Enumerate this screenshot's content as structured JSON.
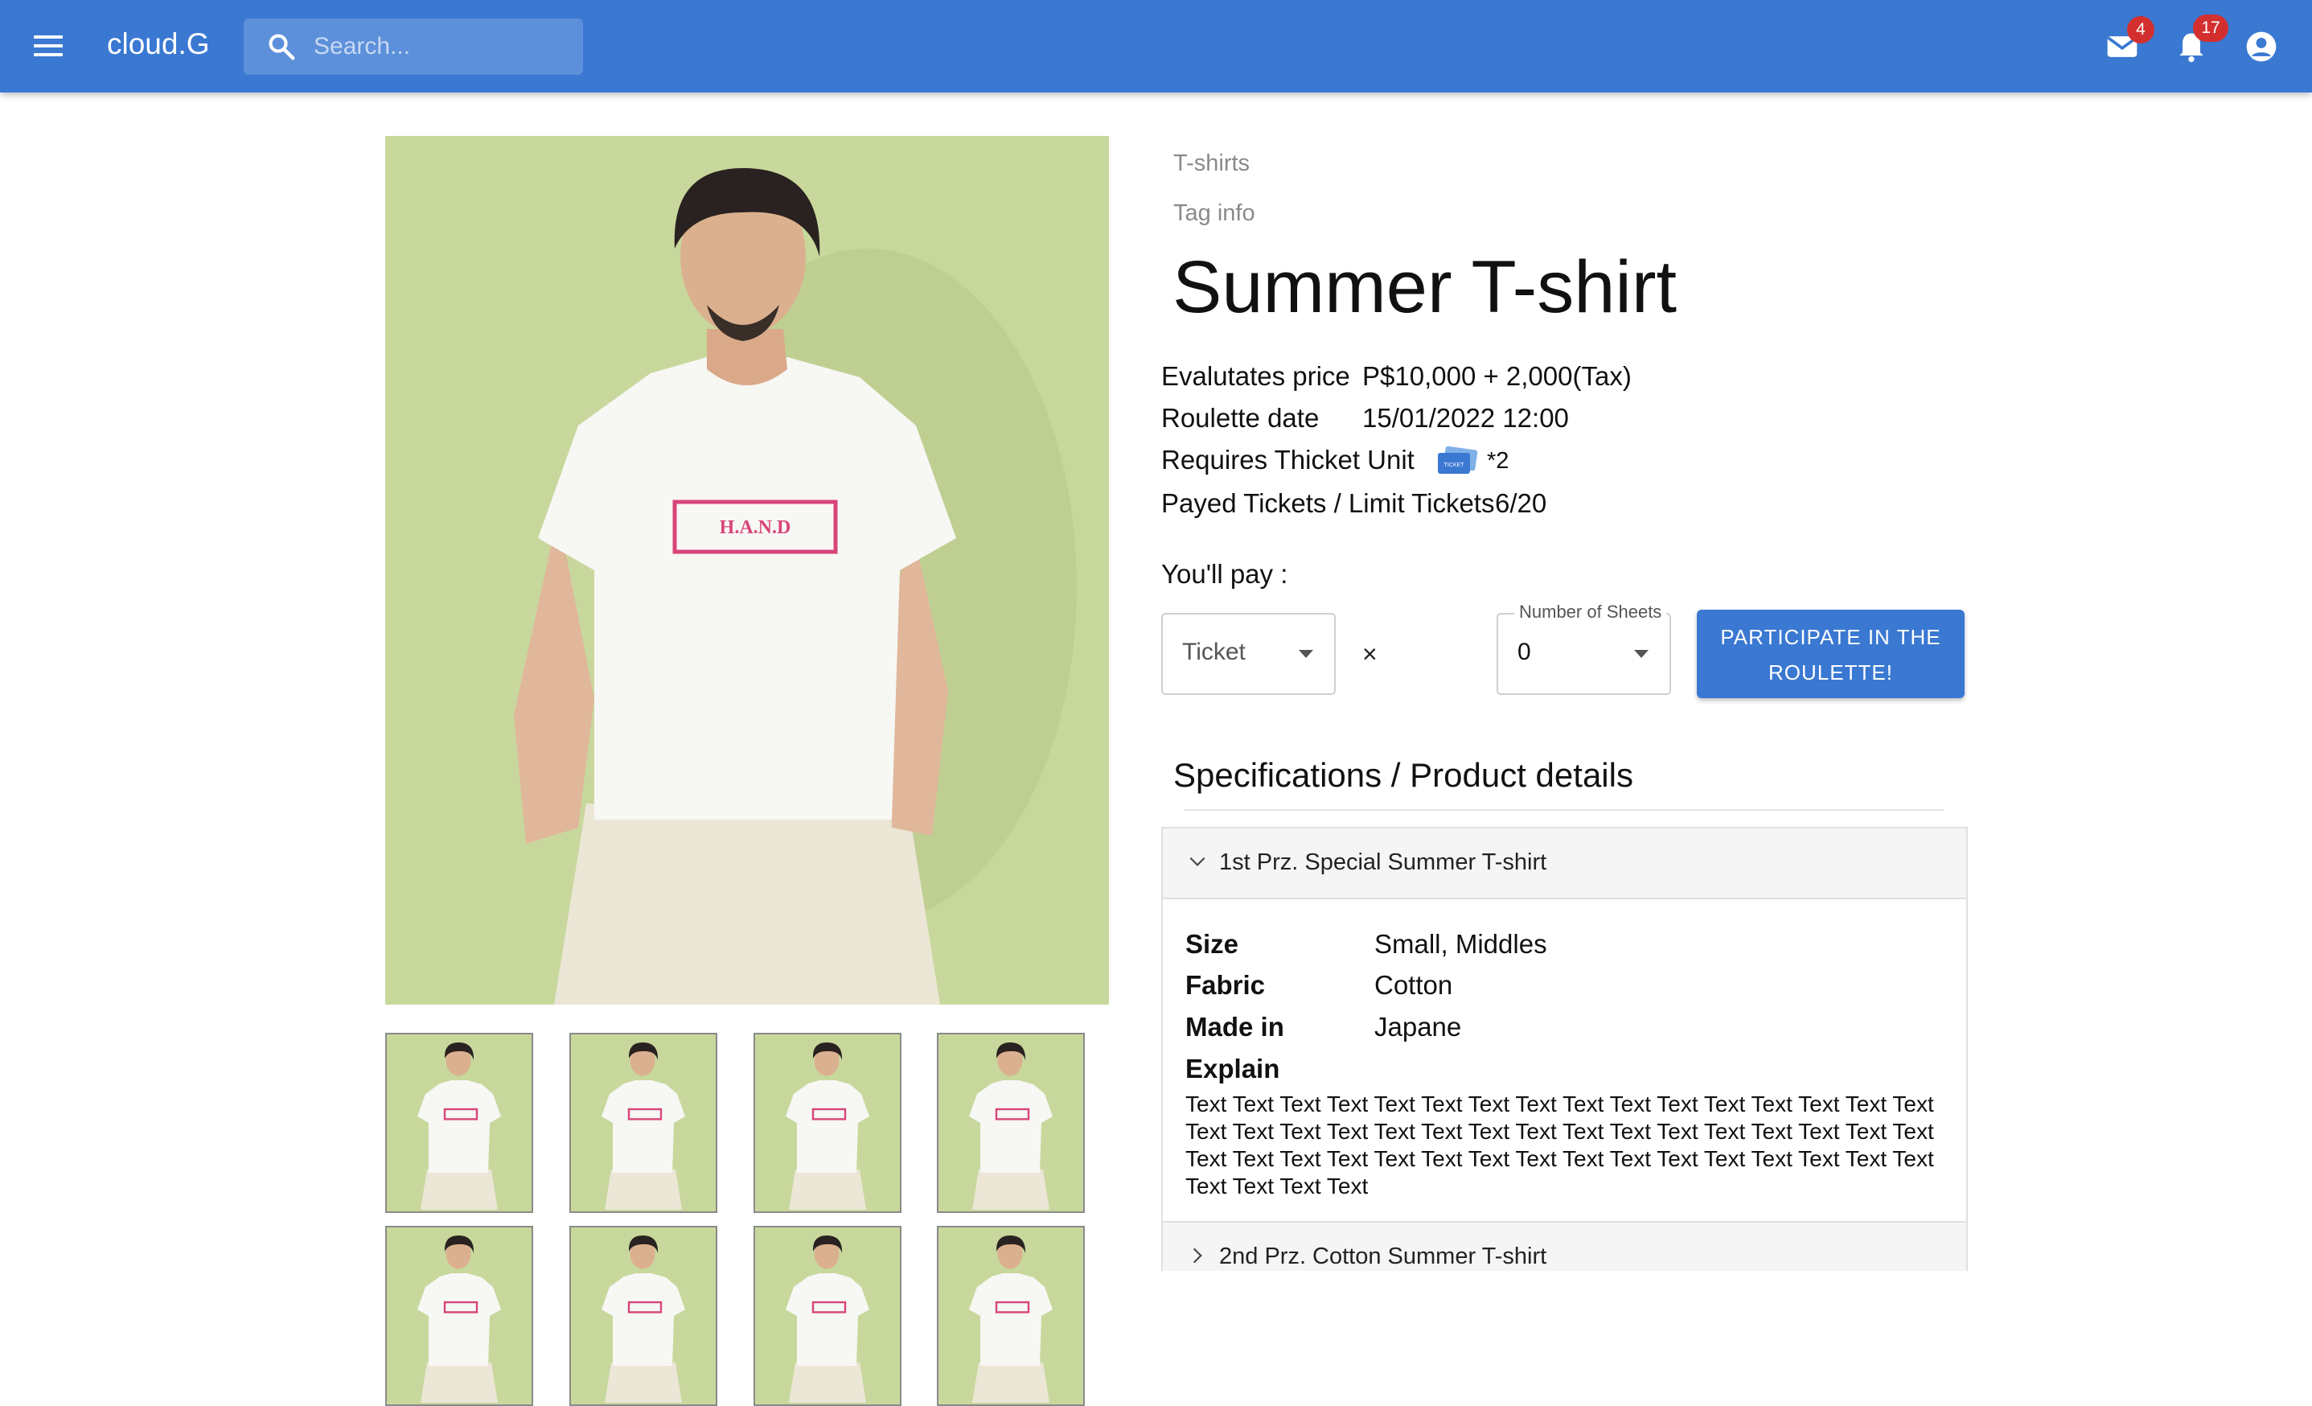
{
  "app": {
    "brand": "cloud.G",
    "search_placeholder": "Search...",
    "mail_badge": "4",
    "notification_badge": "17"
  },
  "product": {
    "category": "T-shirts",
    "tag_info": "Tag info",
    "title": "Summer T-shirt",
    "image_print_text": "H.A.N.D",
    "info": {
      "price_label": "Evalutates price",
      "price_value": "P$10,000 + 2,000(Tax)",
      "roulette_label": "Roulette date",
      "roulette_value": "15/01/2022 12:00",
      "ticket_unit_label": "Requires Thicket Unit",
      "ticket_unit_value": "*2",
      "ticket_icon_text": "TICKET",
      "tickets_label": "Payed Tickets / Limit Tickets",
      "tickets_value": "6/20"
    }
  },
  "purchase": {
    "youpay_label": "You'll pay :",
    "currency_select_value": "Ticket",
    "times_symbol": "×",
    "sheets_label": "Number of Sheets",
    "sheets_value": "0",
    "cta_line1": "PARTICIPATE IN THE",
    "cta_line2": "ROULETTE!"
  },
  "specs": {
    "section_title": "Specifications / Product details",
    "prize1": {
      "header": "1st Prz. Special Summer T-shirt",
      "size_key": "Size",
      "size_value": "Small, Middles",
      "fabric_key": "Fabric",
      "fabric_value": "Cotton",
      "made_key": "Made in",
      "made_value": "Japane",
      "explain_key": "Explain",
      "explain_text": "Text Text Text Text Text Text Text Text Text Text Text Text Text Text Text Text Text Text Text Text Text Text Text Text Text Text Text Text Text Text Text Text Text Text Text Text Text Text Text Text Text Text Text Text Text Text Text Text Text Text Text Text"
    },
    "prize2": {
      "header": "2nd Prz. Cotton Summer T-shirt"
    }
  },
  "colors": {
    "primary": "#3a78d2",
    "badge": "#d32f2f",
    "photo_background": "#c8d89c"
  }
}
